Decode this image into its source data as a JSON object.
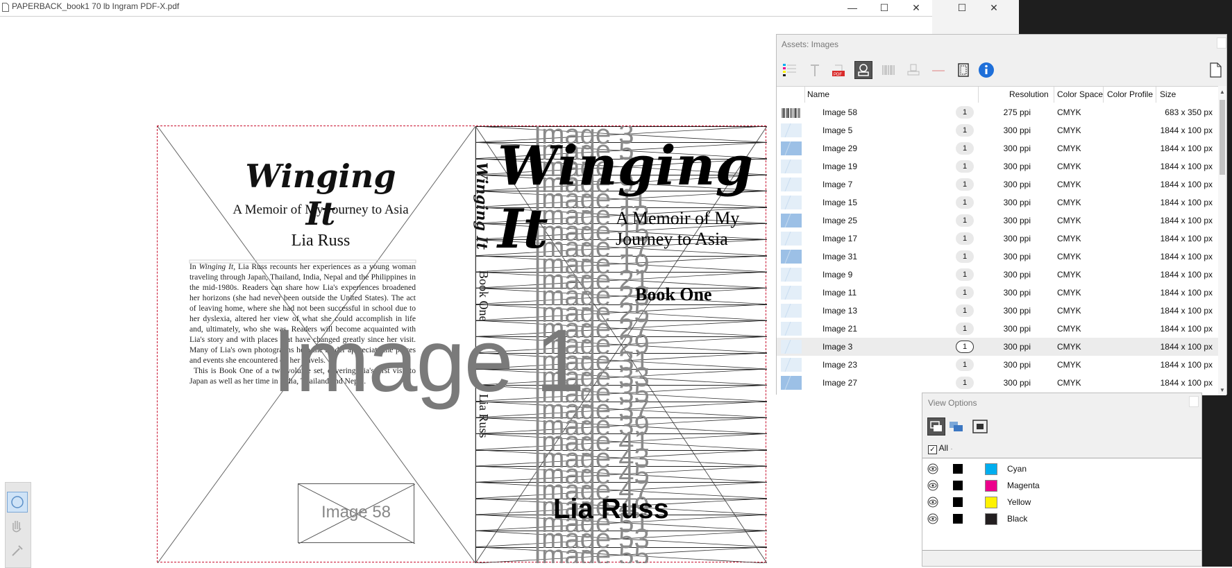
{
  "window": {
    "title": "PAPERBACK_book1 70 lb Ingram PDF-X.pdf",
    "minimize": "—",
    "maximize": "☐",
    "close": "✕"
  },
  "cover": {
    "back_title": "Winging It",
    "back_subtitle": "A Memoir of My Journey to Asia",
    "back_author": "Lia Russ",
    "blurb_p1_a": "In ",
    "blurb_p1_em": "Winging It,",
    "blurb_p1_b": " Lia Russ recounts her experiences as a young woman traveling through Japan, Thailand, India, Nepal and the Philippines in the mid-1980s.  Readers can share how Lia's experiences broadened her horizons (she had never been outside the United States).  The act of leaving home, where she had not been successful in school due to her dyslexia, altered her view of what she could accomplish in life and, ultimately, who she was.  Readers will become acquainted with Lia's story and with places that have changed greatly since her visit.  Many of Lia's own photographs help the reader appreciate the places and events she encountered on her travels.",
    "blurb_p2": "This is Book One of a two-volume set, covering Lia's first visit to Japan as well as her time in India, Thailand and Nepal.",
    "spine_title": "Winging It",
    "spine_book": "Book One",
    "spine_author": "Lia Russ",
    "image58_label": "Image 58",
    "image1_label": "Image 1",
    "front_title": "Winging It",
    "front_subtitle": "A Memoir of My Journey to Asia",
    "front_book": "Book One",
    "front_author": "Lia Russ",
    "stacked_image_labels": [
      "Image 3",
      "Image 5",
      "Image 7",
      "Image 9",
      "Image 11",
      "Image 13",
      "Image 15",
      "Image 17",
      "Image 19",
      "Image 21",
      "Image 23",
      "Image 25",
      "Image 27",
      "Image 29",
      "Image 31",
      "Image 33",
      "Image 35",
      "Image 37",
      "Image 39",
      "Image 41",
      "Image 43",
      "Image 45",
      "Image 47",
      "Image 49",
      "Image 51",
      "Image 53",
      "Image 55"
    ]
  },
  "assets_panel": {
    "title": "Assets: Images",
    "columns": {
      "name": "Name",
      "resolution": "Resolution",
      "color_space": "Color Space",
      "color_profile": "Color Profile",
      "size": "Size"
    },
    "rows": [
      {
        "name": "Image 58",
        "count": "1",
        "resolution": "275 ppi",
        "color_space": "CMYK",
        "size": "683 x 350 px",
        "thumb": "barcode"
      },
      {
        "name": "Image 5",
        "count": "1",
        "resolution": "300 ppi",
        "color_space": "CMYK",
        "size": "1844 x 100 px",
        "thumb": "light"
      },
      {
        "name": "Image 29",
        "count": "1",
        "resolution": "300 ppi",
        "color_space": "CMYK",
        "size": "1844 x 100 px",
        "thumb": "blue"
      },
      {
        "name": "Image 19",
        "count": "1",
        "resolution": "300 ppi",
        "color_space": "CMYK",
        "size": "1844 x 100 px",
        "thumb": "light"
      },
      {
        "name": "Image 7",
        "count": "1",
        "resolution": "300 ppi",
        "color_space": "CMYK",
        "size": "1844 x 100 px",
        "thumb": "light"
      },
      {
        "name": "Image 15",
        "count": "1",
        "resolution": "300 ppi",
        "color_space": "CMYK",
        "size": "1844 x 100 px",
        "thumb": "light"
      },
      {
        "name": "Image 25",
        "count": "1",
        "resolution": "300 ppi",
        "color_space": "CMYK",
        "size": "1844 x 100 px",
        "thumb": "blue"
      },
      {
        "name": "Image 17",
        "count": "1",
        "resolution": "300 ppi",
        "color_space": "CMYK",
        "size": "1844 x 100 px",
        "thumb": "light"
      },
      {
        "name": "Image 31",
        "count": "1",
        "resolution": "300 ppi",
        "color_space": "CMYK",
        "size": "1844 x 100 px",
        "thumb": "blue"
      },
      {
        "name": "Image 9",
        "count": "1",
        "resolution": "300 ppi",
        "color_space": "CMYK",
        "size": "1844 x 100 px",
        "thumb": "light"
      },
      {
        "name": "Image 11",
        "count": "1",
        "resolution": "300 ppi",
        "color_space": "CMYK",
        "size": "1844 x 100 px",
        "thumb": "light"
      },
      {
        "name": "Image 13",
        "count": "1",
        "resolution": "300 ppi",
        "color_space": "CMYK",
        "size": "1844 x 100 px",
        "thumb": "light"
      },
      {
        "name": "Image 21",
        "count": "1",
        "resolution": "300 ppi",
        "color_space": "CMYK",
        "size": "1844 x 100 px",
        "thumb": "light"
      },
      {
        "name": "Image 3",
        "count": "1",
        "resolution": "300 ppi",
        "color_space": "CMYK",
        "size": "1844 x 100 px",
        "thumb": "light",
        "selected": true
      },
      {
        "name": "Image 23",
        "count": "1",
        "resolution": "300 ppi",
        "color_space": "CMYK",
        "size": "1844 x 100 px",
        "thumb": "light"
      },
      {
        "name": "Image 27",
        "count": "1",
        "resolution": "300 ppi",
        "color_space": "CMYK",
        "size": "1844 x 100 px",
        "thumb": "blue"
      }
    ],
    "toolbar_icons": [
      "separations-icon",
      "text-icon",
      "pdf-icon",
      "images-icon",
      "barcode-icon",
      "stamp-icon",
      "line-icon",
      "page-box-icon",
      "info-icon",
      "document-icon"
    ]
  },
  "view_options": {
    "title": "View Options",
    "all_label": "All",
    "separations": [
      {
        "name": "Cyan",
        "color": "#00aeef"
      },
      {
        "name": "Magenta",
        "color": "#ec008c"
      },
      {
        "name": "Yellow",
        "color": "#fff200"
      },
      {
        "name": "Black",
        "color": "#231f20"
      }
    ]
  },
  "colors": {
    "bleed_border": "#c8102e",
    "placeholder_gray": "#7a7a7a",
    "info_blue": "#1e6fd9"
  }
}
